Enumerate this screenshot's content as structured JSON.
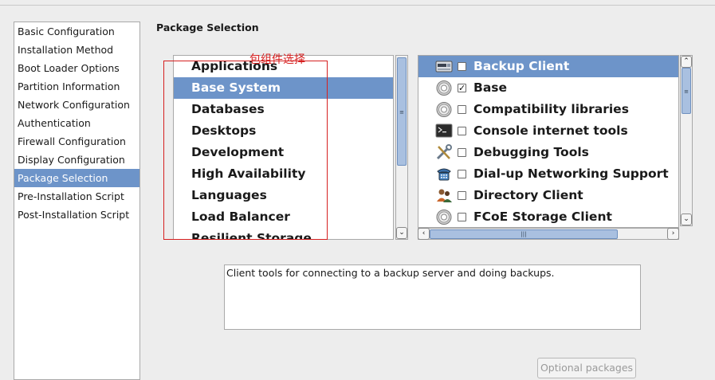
{
  "page": {
    "title": "Package Selection"
  },
  "nav": {
    "items": [
      {
        "label": "Basic Configuration",
        "selected": false
      },
      {
        "label": "Installation Method",
        "selected": false
      },
      {
        "label": "Boot Loader Options",
        "selected": false
      },
      {
        "label": "Partition Information",
        "selected": false
      },
      {
        "label": "Network Configuration",
        "selected": false
      },
      {
        "label": "Authentication",
        "selected": false
      },
      {
        "label": "Firewall Configuration",
        "selected": false
      },
      {
        "label": "Display Configuration",
        "selected": false
      },
      {
        "label": "Package Selection",
        "selected": true
      },
      {
        "label": "Pre-Installation Script",
        "selected": false
      },
      {
        "label": "Post-Installation Script",
        "selected": false
      }
    ]
  },
  "groups": {
    "items": [
      {
        "label": "Applications",
        "selected": false
      },
      {
        "label": "Base System",
        "selected": true
      },
      {
        "label": "Databases",
        "selected": false
      },
      {
        "label": "Desktops",
        "selected": false
      },
      {
        "label": "Development",
        "selected": false
      },
      {
        "label": "High Availability",
        "selected": false
      },
      {
        "label": "Languages",
        "selected": false
      },
      {
        "label": "Load Balancer",
        "selected": false
      },
      {
        "label": "Resilient Storage",
        "selected": false
      }
    ]
  },
  "packages": {
    "items": [
      {
        "label": "Backup Client",
        "checked": false,
        "selected": true,
        "icon": "backup-drive-icon"
      },
      {
        "label": "Base",
        "checked": true,
        "selected": false,
        "icon": "gear-icon"
      },
      {
        "label": "Compatibility libraries",
        "checked": false,
        "selected": false,
        "icon": "gear-icon"
      },
      {
        "label": "Console internet tools",
        "checked": false,
        "selected": false,
        "icon": "terminal-icon"
      },
      {
        "label": "Debugging Tools",
        "checked": false,
        "selected": false,
        "icon": "tools-icon"
      },
      {
        "label": "Dial-up Networking Support",
        "checked": false,
        "selected": false,
        "icon": "phone-icon"
      },
      {
        "label": "Directory Client",
        "checked": false,
        "selected": false,
        "icon": "users-icon"
      },
      {
        "label": "FCoE Storage Client",
        "checked": false,
        "selected": false,
        "icon": "gear-icon"
      }
    ]
  },
  "description": "Client tools for connecting to a backup server and doing backups.",
  "buttons": {
    "optional_packages": "Optional packages"
  },
  "annotation": {
    "text": "包组件选择"
  },
  "colors": {
    "selection": "#6d94c9",
    "annotation": "#d62020"
  }
}
